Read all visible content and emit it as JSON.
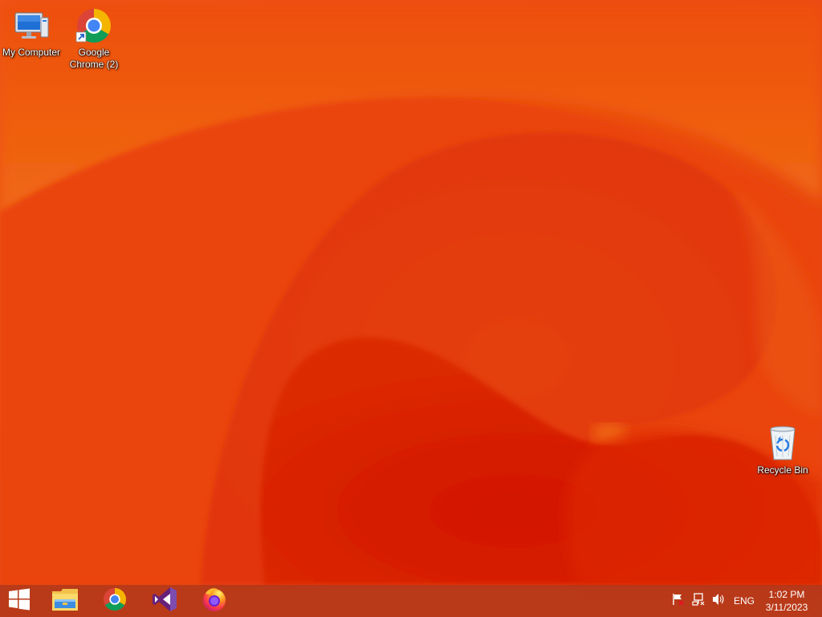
{
  "desktop": {
    "icons": [
      {
        "label": "My Computer",
        "icon": "computer-icon"
      },
      {
        "label": "Google Chrome (2)",
        "icon": "chrome-icon"
      },
      {
        "label": "Recycle Bin",
        "icon": "recycle-bin-icon"
      }
    ]
  },
  "taskbar": {
    "start": {
      "icon": "windows-logo-icon"
    },
    "pinned": [
      {
        "name": "File Explorer",
        "icon": "file-explorer-icon"
      },
      {
        "name": "Google Chrome",
        "icon": "chrome-icon"
      },
      {
        "name": "Visual Studio",
        "icon": "visual-studio-icon"
      },
      {
        "name": "Firefox",
        "icon": "firefox-icon"
      }
    ],
    "tray": {
      "icons": [
        "action-center-flag-icon",
        "network-icon",
        "volume-icon"
      ],
      "language": "ENG",
      "time": "1:02 PM",
      "date": "3/11/2023"
    }
  },
  "colors": {
    "wallpaper_base": "#ea4a0e",
    "wallpaper_dark": "#d41a04",
    "wallpaper_light": "#f26a10",
    "taskbar": "#b8401c"
  }
}
